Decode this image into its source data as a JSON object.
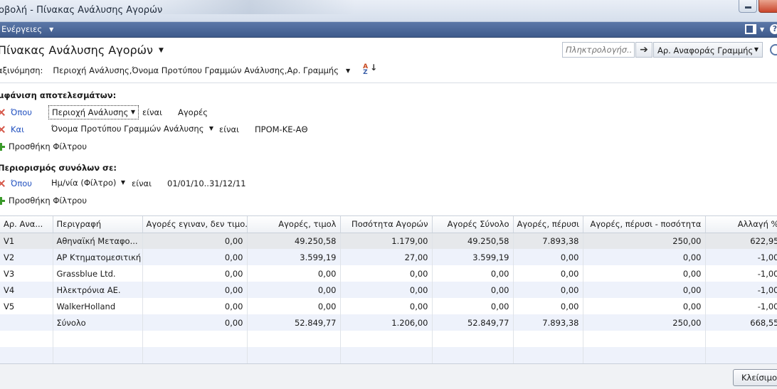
{
  "window": {
    "title": "οβολή - Πίνακας Ανάλυσης Αγορών"
  },
  "commandbar": {
    "actions_label": "Ενέργειες"
  },
  "page": {
    "title": "Πίνακας Ανάλυσης Αγορών",
    "search_placeholder": "Πληκτρολογήσ...",
    "search_field": "Αρ. Αναφοράς Γραμμής",
    "sort_label": "αξινόμηση:",
    "sort_value": "Περιοχή Ανάλυσης,Όνομα Προτύπου Γραμμών Ανάλυσης,Αρ. Γραμμής"
  },
  "filters": {
    "results_heading": "μφάνιση αποτελεσμάτων:",
    "rows": [
      {
        "connector": "Όπου",
        "field": "Περιοχή Ανάλυσης",
        "op": "είναι",
        "value": "Αγορές"
      },
      {
        "connector": "Και",
        "field": "Όνομα Προτύπου Γραμμών Ανάλυσης",
        "op": "είναι",
        "value": "ΠΡΟΜ-ΚΕ-ΑΘ"
      }
    ],
    "add_filter": "Προσθήκη Φίλτρου",
    "totals_heading": "Περιορισμός συνόλων σε:",
    "totals_row": {
      "connector": "Όπου",
      "field": "Ημ/νία (Φίλτρο)",
      "op": "είναι",
      "value": "01/01/10..31/12/11"
    },
    "add_filter2": "Προσθήκη Φίλτρου"
  },
  "grid": {
    "columns": [
      "Αρ. Ανα...",
      "Περιγραφή",
      "Αγορές εγιναν, δεν τιμο...",
      "Αγορές, τιμολ",
      "Ποσότητα Αγορών",
      "Αγορές Σύνολο",
      "Αγορές, πέρυσι",
      "Αγορές, πέρυσι - ποσότητα",
      "Αλλαγή %"
    ],
    "rows": [
      [
        "V1",
        "Αθηναϊκή Μεταφο...",
        "0,00",
        "49.250,58",
        "1.179,00",
        "49.250,58",
        "7.893,38",
        "250,00",
        "622,95"
      ],
      [
        "V2",
        "ΑΡ Κτηματομεσιτική",
        "0,00",
        "3.599,19",
        "27,00",
        "3.599,19",
        "0,00",
        "0,00",
        "-1,00"
      ],
      [
        "V3",
        "Grassblue Ltd.",
        "0,00",
        "0,00",
        "0,00",
        "0,00",
        "0,00",
        "0,00",
        "-1,00"
      ],
      [
        "V4",
        "Ηλεκτρόνια ΑΕ.",
        "0,00",
        "0,00",
        "0,00",
        "0,00",
        "0,00",
        "0,00",
        "-1,00"
      ],
      [
        "V5",
        "WalkerHolland",
        "0,00",
        "0,00",
        "0,00",
        "0,00",
        "0,00",
        "0,00",
        "-1,00"
      ],
      [
        "",
        "Σύνολο",
        "0,00",
        "52.849,77",
        "1.206,00",
        "52.849,77",
        "7.893,38",
        "250,00",
        "668,55"
      ]
    ]
  },
  "footer": {
    "close_label": "Κλείσιμο"
  }
}
